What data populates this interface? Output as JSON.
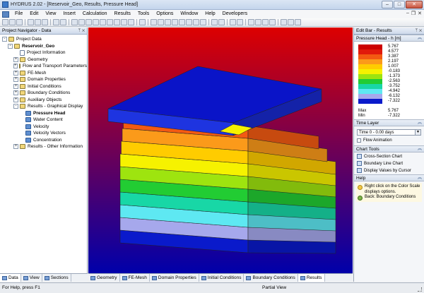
{
  "window": {
    "title": "HYDRUS 2.02 - [Reservoir_Geo, Results, Pressure Head]"
  },
  "menu": [
    "File",
    "Edit",
    "View",
    "Insert",
    "Calculation",
    "Results",
    "Tools",
    "Options",
    "Window",
    "Help",
    "Developers"
  ],
  "navigator": {
    "title": "Project Navigator - Data",
    "items": [
      {
        "label": "Project Data",
        "level": 0,
        "expander": "-",
        "icon": "folder"
      },
      {
        "label": "Reservoir_Geo",
        "level": 1,
        "expander": "-",
        "icon": "folder",
        "bold": true
      },
      {
        "label": "Project Information",
        "level": 2,
        "expander": "",
        "icon": "doc"
      },
      {
        "label": "Geometry",
        "level": 2,
        "expander": "+",
        "icon": "folder"
      },
      {
        "label": "Flow and Transport Parameters",
        "level": 2,
        "expander": "+",
        "icon": "folder"
      },
      {
        "label": "FE-Mesh",
        "level": 2,
        "expander": "+",
        "icon": "folder"
      },
      {
        "label": "Domain Properties",
        "level": 2,
        "expander": "+",
        "icon": "folder"
      },
      {
        "label": "Initial Conditions",
        "level": 2,
        "expander": "+",
        "icon": "folder"
      },
      {
        "label": "Boundary Conditions",
        "level": 2,
        "expander": "+",
        "icon": "folder"
      },
      {
        "label": "Auxiliary Objects",
        "level": 2,
        "expander": "+",
        "icon": "folder"
      },
      {
        "label": "Results - Graphical Display",
        "level": 2,
        "expander": "-",
        "icon": "folder"
      },
      {
        "label": "Pressure Head",
        "level": 3,
        "expander": "",
        "icon": "blue",
        "bold": true
      },
      {
        "label": "Water Content",
        "level": 3,
        "expander": "",
        "icon": "blue"
      },
      {
        "label": "Velocity",
        "level": 3,
        "expander": "",
        "icon": "blue"
      },
      {
        "label": "Velocity Vectors",
        "level": 3,
        "expander": "",
        "icon": "blue"
      },
      {
        "label": "Concentration",
        "level": 3,
        "expander": "",
        "icon": "blue"
      },
      {
        "label": "Results - Other Information",
        "level": 2,
        "expander": "+",
        "icon": "folder"
      }
    ],
    "tabs": [
      "Data",
      "View",
      "Sections"
    ]
  },
  "view_tabs": [
    "Geometry",
    "FE-Mesh",
    "Domain Properties",
    "Initial Conditions",
    "Boundary Conditions",
    "Results"
  ],
  "editbar": {
    "title": "Edit Bar - Results",
    "scale_title": "Pressure Head - h [m]",
    "scale": [
      {
        "value": "5.767",
        "color": "#cc0000"
      },
      {
        "value": "4.577",
        "color": "#e11a0b"
      },
      {
        "value": "3.387",
        "color": "#f35a12"
      },
      {
        "value": "2.197",
        "color": "#fb9a1a"
      },
      {
        "value": "1.007",
        "color": "#ffcc00"
      },
      {
        "value": "-0.183",
        "color": "#f6f200"
      },
      {
        "value": "-1.373",
        "color": "#9ee40f"
      },
      {
        "value": "-2.563",
        "color": "#22cc33"
      },
      {
        "value": "-3.752",
        "color": "#18d7a6"
      },
      {
        "value": "-4.942",
        "color": "#5ee8f2"
      },
      {
        "value": "-6.132",
        "color": "#a6a8ec"
      },
      {
        "value": "-7.322",
        "color": "#0a1acb"
      }
    ],
    "max_label": "Max",
    "max_value": "5.767",
    "min_label": "Min",
    "min_value": "-7.322",
    "time_layer_title": "Time Layer",
    "time_select": "Time 0 - 0.00 days",
    "flow_animation": "Flow Animation",
    "chart_tools_title": "Chart Tools",
    "chart_tools": [
      "Cross-Section Chart",
      "Boundary Line Chart",
      "Display Values by Cursor"
    ],
    "help_title": "Help",
    "help_text": "Right click on the Color Scale displays options.",
    "help_back": "Back: Boundary Conditions"
  },
  "status": {
    "left": "For Help, press F1",
    "mid": "Partial View"
  },
  "colors": {
    "viewport_top": "#dd0000",
    "viewport_bottom": "#0000aa"
  }
}
